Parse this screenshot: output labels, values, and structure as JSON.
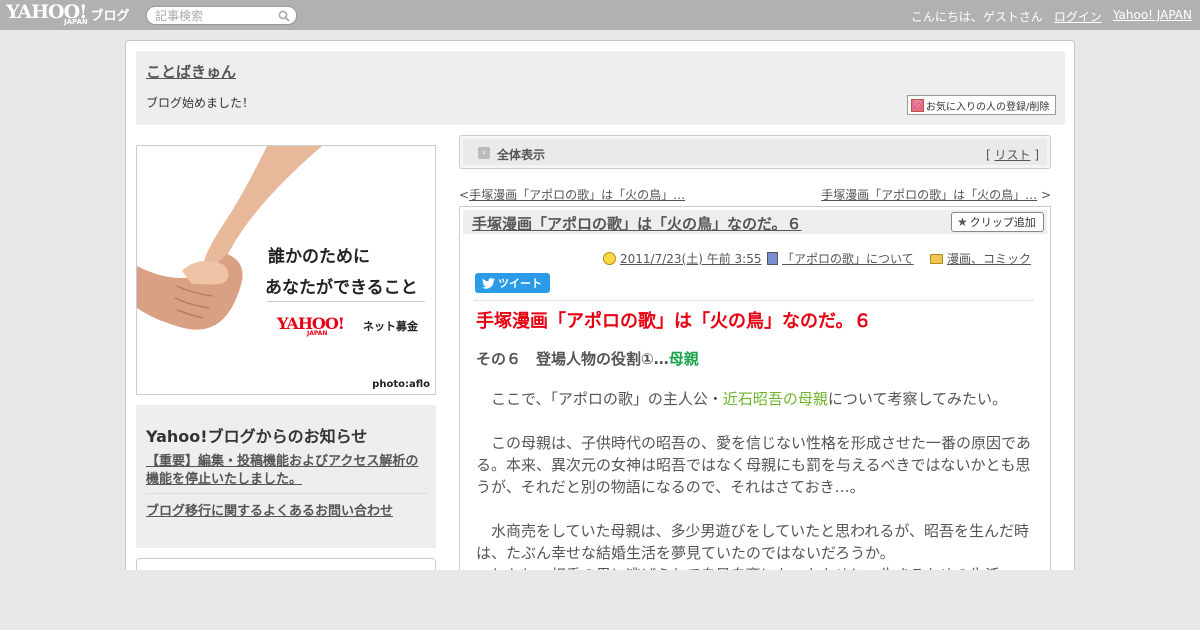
{
  "topbar": {
    "logo_text": "YAHOO!",
    "logo_sub": "JAPAN",
    "logo_blog": "ブログ",
    "search_placeholder": "記事検索",
    "greeting": "こんにちは、ゲストさん",
    "login": "ログイン",
    "yahoo_japan": "Yahoo! JAPAN"
  },
  "header": {
    "blog_title": "ことばきゅん",
    "blog_description": "ブログ始めました！",
    "fav_button": "お気に入りの人の登録/削除"
  },
  "banner": {
    "line1": "誰かのために",
    "line2": "あなたができること",
    "logo_text": "YAHOO!",
    "logo_sub": "JAPAN",
    "net_label": "ネット募金",
    "photo_credit": "photo:aflo"
  },
  "notice": {
    "title": "Yahoo!ブログからのお知らせ",
    "link1": "【重要】編集・投稿機能およびアクセス解析の機能を停止いたしました。",
    "link2": "ブログ移行に関するよくあるお問い合わせ"
  },
  "allview": {
    "label": "全体表示",
    "list_open": "[ ",
    "list_link": "リスト",
    "list_close": " ]"
  },
  "nav": {
    "prev_arrow": "<",
    "prev_link": "手塚漫画「アポロの歌」は「火の鳥」…",
    "next_link": "手塚漫画「アポロの歌」は「火の鳥」…",
    "next_arrow": " >"
  },
  "article": {
    "title": "手塚漫画「アポロの歌」は「火の鳥」なのだ。６",
    "clip_button": "クリップ追加",
    "date": "2011/7/23(土) 午前 3:55",
    "book": "「アポロの歌」について",
    "category": "漫画、コミック",
    "tweet": "ツイート",
    "body_title": "手塚漫画「アポロの歌」は「火の鳥」なのだ。６",
    "subhead_prefix": "その６　登場人物の役割①…",
    "subhead_highlight": "母親",
    "para1_prefix": "　ここで、「アポロの歌」の主人公・",
    "para1_highlight": "近石昭吾の母親",
    "para1_suffix": "について考察してみたい。",
    "para2": "　この母親は、子供時代の昭吾の、愛を信じない性格を形成させた一番の原因である。本来、異次元の女神は昭吾ではなく母親にも罰を与えるべきではないかとも思うが、それだと別の物語になるので、それはさておき…。",
    "para3": "　水商売をしていた母親は、多少男遊びをしていたと思われるが、昭吾を生んだ時は、たぶん幸せな結婚生活を夢見ていたのではないだろうか。",
    "para4": "　しかし、相手の男に逃げられて自暴自棄になったために、生きるための生活"
  }
}
